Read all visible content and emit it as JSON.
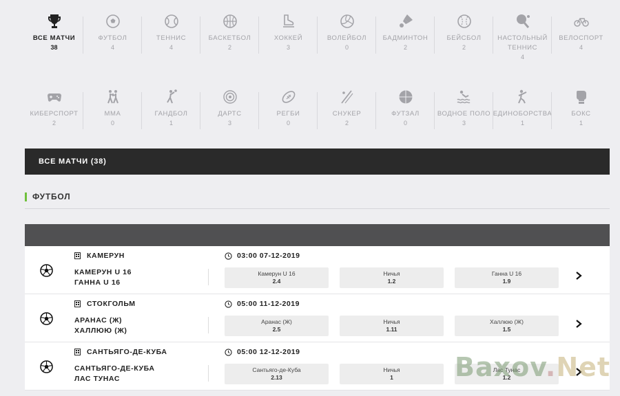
{
  "sports_row1": [
    {
      "name": "ВСЕ МАТЧИ",
      "count": "38",
      "icon": "trophy-icon",
      "active": true
    },
    {
      "name": "ФУТБОЛ",
      "count": "4",
      "icon": "soccer-ball-icon"
    },
    {
      "name": "ТЕННИС",
      "count": "4",
      "icon": "tennis-ball-icon"
    },
    {
      "name": "БАСКЕТБОЛ",
      "count": "2",
      "icon": "basketball-icon"
    },
    {
      "name": "ХОККЕЙ",
      "count": "3",
      "icon": "skate-icon"
    },
    {
      "name": "ВОЛЕЙБОЛ",
      "count": "0",
      "icon": "volleyball-icon"
    },
    {
      "name": "БАДМИНТОН",
      "count": "2",
      "icon": "shuttlecock-icon"
    },
    {
      "name": "БЕЙСБОЛ",
      "count": "2",
      "icon": "baseball-icon"
    },
    {
      "name": "НАСТОЛЬНЫЙ ТЕННИС",
      "count": "4",
      "icon": "table-tennis-icon"
    },
    {
      "name": "ВЕЛОСПОРТ",
      "count": "4",
      "icon": "bicycle-icon"
    }
  ],
  "sports_row2": [
    {
      "name": "КИБЕРСПОРТ",
      "count": "2",
      "icon": "gamepad-icon"
    },
    {
      "name": "MMA",
      "count": "0",
      "icon": "fighters-icon"
    },
    {
      "name": "ГАНДБОЛ",
      "count": "1",
      "icon": "handball-icon"
    },
    {
      "name": "ДАРТС",
      "count": "3",
      "icon": "dartboard-icon"
    },
    {
      "name": "РЕГБИ",
      "count": "0",
      "icon": "rugby-ball-icon"
    },
    {
      "name": "СНУКЕР",
      "count": "2",
      "icon": "snooker-cue-icon"
    },
    {
      "name": "ФУТЗАЛ",
      "count": "0",
      "icon": "futsal-ball-icon"
    },
    {
      "name": "ВОДНОЕ ПОЛО",
      "count": "3",
      "icon": "swimmer-icon"
    },
    {
      "name": "ЕДИНОБОРСТВА",
      "count": "1",
      "icon": "martial-arts-icon"
    },
    {
      "name": "БОКС",
      "count": "1",
      "icon": "boxing-glove-icon"
    }
  ],
  "all_matches_bar": "ВСЕ МАТЧИ (38)",
  "section_title": "ФУТБОЛ",
  "matches": [
    {
      "location": "КАМЕРУН",
      "time": "03:00 07-12-2019",
      "team1": "КАМЕРУН U 16",
      "team2": "ГАННА U 16",
      "odds": [
        {
          "label": "Камерун U 16",
          "value": "2.4"
        },
        {
          "label": "Ничья",
          "value": "1.2"
        },
        {
          "label": "Ганна U 16",
          "value": "1.9"
        }
      ]
    },
    {
      "location": "СТОКГОЛЬМ",
      "time": "05:00 11-12-2019",
      "team1": "АРАНАС (Ж)",
      "team2": "ХАЛЛЮЮ (Ж)",
      "odds": [
        {
          "label": "Аранас (Ж)",
          "value": "2.5"
        },
        {
          "label": "Ничья",
          "value": "1.11"
        },
        {
          "label": "Халлюю (Ж)",
          "value": "1.5"
        }
      ]
    },
    {
      "location": "САНТЬЯГО-ДЕ-КУБА",
      "time": "05:00 12-12-2019",
      "team1": "САНТЬЯГО-ДЕ-КУБА",
      "team2": "ЛАС ТУНАС",
      "odds": [
        {
          "label": "Сантьяго-де-Куба",
          "value": "2.13"
        },
        {
          "label": "Ничья",
          "value": "1"
        },
        {
          "label": "Лас Тунас",
          "value": "1.2"
        }
      ]
    }
  ],
  "watermark": {
    "part1": "Baxov",
    "part2": ".",
    "part3": "Net"
  },
  "colors": {
    "accent": "#6fc03c",
    "bar": "#2a2a2a",
    "header": "#505052",
    "muted": "#a3a3a8"
  }
}
